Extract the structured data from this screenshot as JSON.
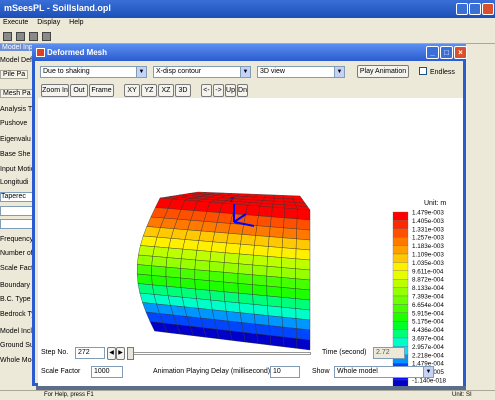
{
  "bg": {
    "title": "mSeesPL - SoilIsland.opl",
    "menu": [
      "Execute",
      "Display",
      "Help"
    ],
    "left_items": [
      "Model Input",
      "Model Defin",
      "Pile Pa",
      "Mesh Pa",
      "Analysis Typ",
      "Pushove",
      "Eigenvalu",
      "Base She",
      "Input Motion",
      "Longitudi",
      "Taperec",
      "",
      "",
      "Frequency (B",
      "Number of C",
      "Scale Factor",
      "Boundary Co",
      "B.C. Type",
      "Bedrock Ty",
      "Model Inclin",
      "Ground Surfa",
      "Whole Mode"
    ],
    "status_left": "For Help, press F1",
    "status_right": "Unit: SI"
  },
  "window": {
    "title": "Deformed Mesh",
    "loading_select": "Due to shaking",
    "contour_select": "X-disp contour",
    "view_select": "3D view",
    "play_button": "Play Animation",
    "endless_label": "Endless",
    "toolbar": [
      "Zoom In",
      "Out",
      "Frame",
      "XY",
      "YZ",
      "XZ",
      "3D",
      "<-",
      "->",
      "Up",
      "Dn"
    ],
    "step_label": "Step No.",
    "step_value": "272",
    "time_label": "Time (second)",
    "time_value": "2.72",
    "scale_label": "Scale Factor",
    "scale_value": "1000",
    "delay_label": "Animation Playing Delay (millisecond)",
    "delay_value": "10",
    "show_label": "Show",
    "show_value": "Whole model"
  },
  "plot": {
    "axis_label": "Z",
    "unit_label": "Unit: m",
    "legend_values": [
      "1.479e-003",
      "1.405e-003",
      "1.331e-003",
      "1.257e-003",
      "1.183e-003",
      "1.109e-003",
      "1.035e-003",
      "9.611e-004",
      "8.872e-004",
      "8.133e-004",
      "7.393e-004",
      "6.654e-004",
      "5.915e-004",
      "5.175e-004",
      "4.436e-004",
      "3.697e-004",
      "2.957e-004",
      "2.218e-004",
      "1.479e-004",
      "7.393e-005",
      "-1.140e-018"
    ],
    "legend_colors": [
      "#ff0000",
      "#ff2800",
      "#ff5000",
      "#ff7800",
      "#ffa000",
      "#ffc800",
      "#fff000",
      "#e6ff00",
      "#beff00",
      "#96ff00",
      "#6eff00",
      "#46ff00",
      "#1eff00",
      "#00ff28",
      "#00ff78",
      "#00ffc8",
      "#00e6ff",
      "#0096ff",
      "#0046ff",
      "#0010ff",
      "#0000c8"
    ]
  }
}
